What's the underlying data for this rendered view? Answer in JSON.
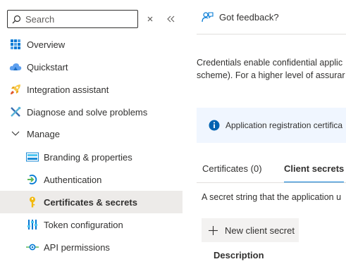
{
  "nav": {
    "search_placeholder": "Search",
    "items": [
      {
        "label": "Overview",
        "icon": "overview-grid-icon"
      },
      {
        "label": "Quickstart",
        "icon": "cloud-icon"
      },
      {
        "label": "Integration assistant",
        "icon": "rocket-icon"
      },
      {
        "label": "Diagnose and solve problems",
        "icon": "wrench-icon"
      },
      {
        "label": "Manage",
        "icon": "chevron-down-icon"
      },
      {
        "label": "Branding & properties",
        "icon": "branding-icon"
      },
      {
        "label": "Authentication",
        "icon": "authentication-icon"
      },
      {
        "label": "Certificates & secrets",
        "icon": "key-icon",
        "selected": true
      },
      {
        "label": "Token configuration",
        "icon": "token-bars-icon"
      },
      {
        "label": "API permissions",
        "icon": "api-permissions-icon"
      }
    ]
  },
  "toolbar": {
    "feedback_label": "Got feedback?"
  },
  "main": {
    "description_line1": "Credentials enable confidential applic",
    "description_line2": "scheme). For a higher level of assurar",
    "info_text": "Application registration certifica",
    "tabs": [
      {
        "label": "Certificates (0)",
        "active": false
      },
      {
        "label": "Client secrets",
        "active": true
      }
    ],
    "secret_description": "A secret string that the application u",
    "new_secret_label": "New client secret",
    "column_description": "Description"
  },
  "colors": {
    "accent": "#0078d4",
    "selected_bg": "#edebe9",
    "info_bg": "#f0f6ff"
  }
}
